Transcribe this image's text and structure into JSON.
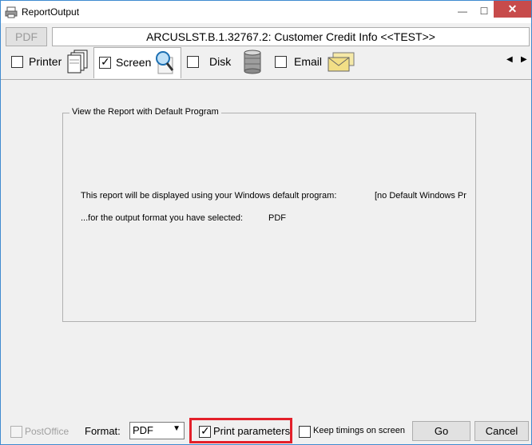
{
  "window": {
    "title": "ReportOutput"
  },
  "toolbar": {
    "format_badge": "PDF",
    "report_title": "ARCUSLST.B.1.32767.2: Customer Credit Info <<TEST>>"
  },
  "tabs": [
    {
      "label": "Printer",
      "checked": false,
      "icon": "printer-stack-icon"
    },
    {
      "label": "Screen",
      "checked": true,
      "icon": "magnifier-icon"
    },
    {
      "label": "Disk",
      "checked": false,
      "icon": "database-icon"
    },
    {
      "label": "Email",
      "checked": false,
      "icon": "envelope-icon"
    }
  ],
  "panel": {
    "group_title": "View the Report with Default Program",
    "line1_text": "This report will be displayed using your Windows default program:",
    "line1_value": "[no Default Windows Pr",
    "line2_text": "...for the output format you have selected:",
    "line2_value": "PDF"
  },
  "bottom": {
    "postoffice_label": "PostOffice",
    "format_label": "Format:",
    "format_value": "PDF",
    "print_params_label": "Print parameters",
    "print_params_checked": true,
    "keep_timings_label": "Keep timings on screen",
    "keep_timings_checked": false,
    "go_label": "Go",
    "cancel_label": "Cancel"
  },
  "colors": {
    "highlight": "#e3202a",
    "window_border": "#3f8bd0",
    "close_button": "#c74b4b"
  }
}
